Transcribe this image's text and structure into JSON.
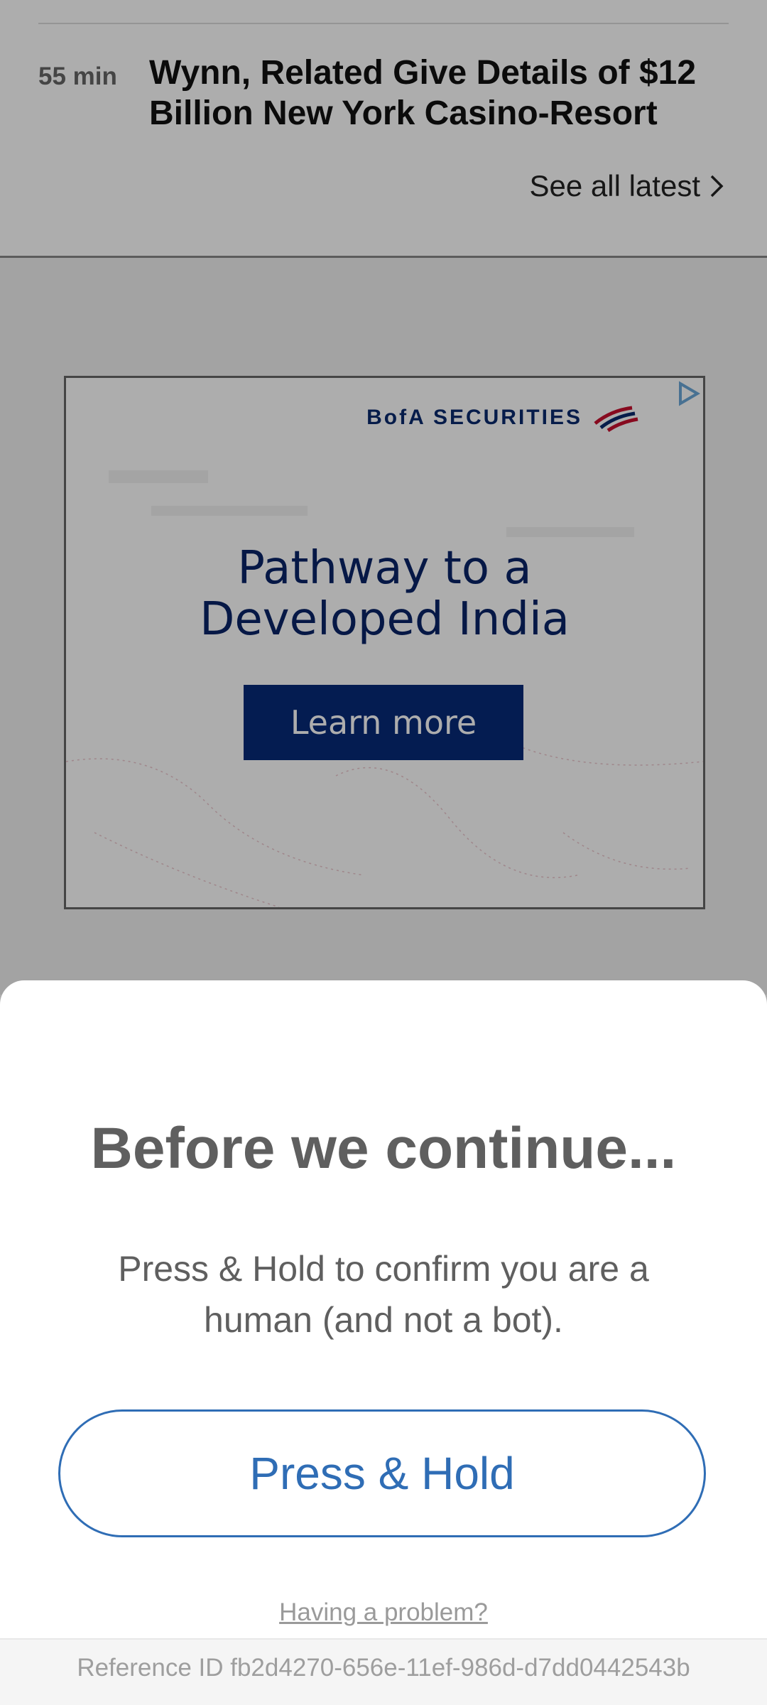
{
  "news": {
    "time": "55 min",
    "title": "Wynn, Related Give Details of $12 Billion New York Casino-Resort",
    "see_all": "See all latest"
  },
  "ad": {
    "brand": "BofA SECURITIES",
    "headline_line1": "Pathway to a",
    "headline_line2": "Developed India",
    "cta": "Learn more"
  },
  "sheet": {
    "title": "Before we continue...",
    "description": "Press & Hold to confirm you are a human (and not a bot).",
    "button": "Press & Hold",
    "problem_link": "Having a problem?",
    "reference": "Reference ID fb2d4270-656e-11ef-986d-d7dd0442543b"
  },
  "colors": {
    "accent": "#2f6db5",
    "ad_navy": "#062a78",
    "title_gray": "#5f5f5f"
  }
}
